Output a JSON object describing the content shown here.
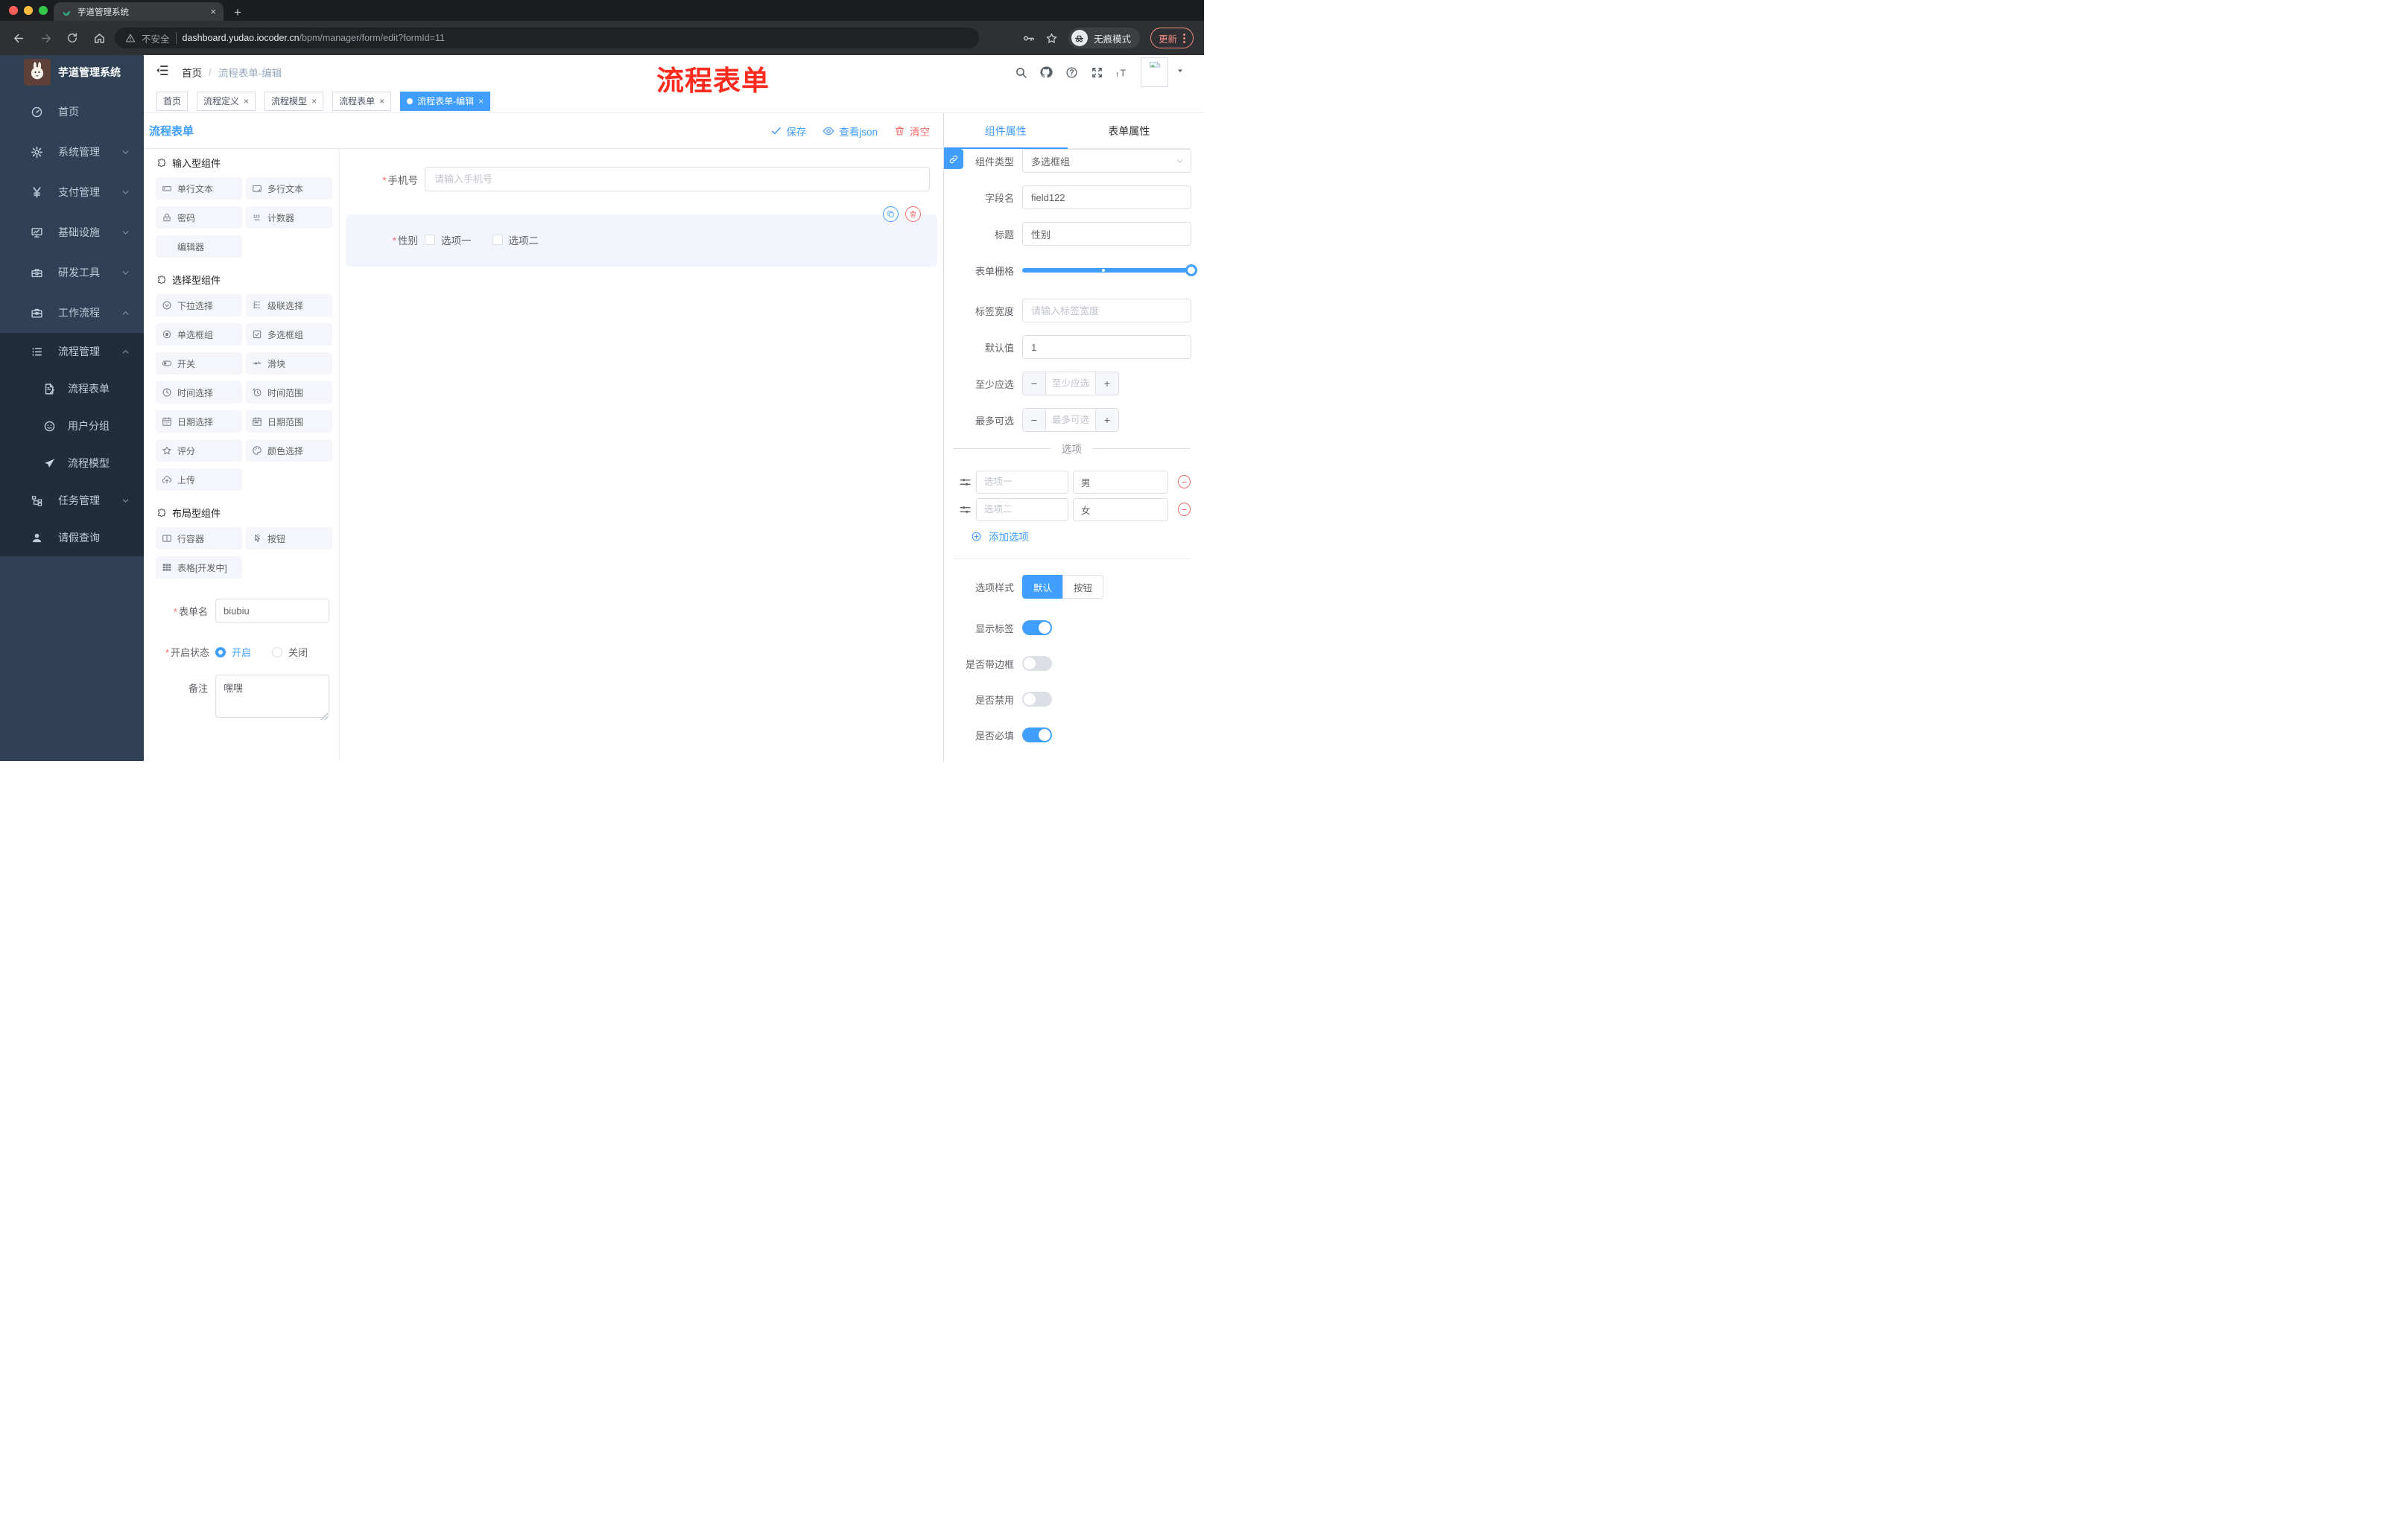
{
  "colors": {
    "accent": "#409eff",
    "danger": "#f56c6c",
    "sidebar_bg": "#304156",
    "submenu_bg": "#1f2d3d",
    "tag_active_bg": "#409eff"
  },
  "browser": {
    "tab_title": "芋道管理系统",
    "security_label": "不安全",
    "url_host": "dashboard.yudao.iocoder.cn",
    "url_path": "/bpm/manager/form/edit?formId=11",
    "incognito_label": "无痕模式",
    "update_label": "更新"
  },
  "sidebar": {
    "logo_title": "芋道管理系统",
    "top_items": [
      {
        "label": "首页",
        "icon": "ic-gauge"
      },
      {
        "label": "系统管理",
        "icon": "ic-gear",
        "classes": [
          "chev-down"
        ]
      },
      {
        "label": "支付管理",
        "icon": "ic-yen",
        "classes": [
          "chev-down"
        ]
      },
      {
        "label": "基础设施",
        "icon": "ic-monitor",
        "classes": [
          "chev-down"
        ]
      },
      {
        "label": "研发工具",
        "icon": "ic-toolbox",
        "classes": [
          "chev-down"
        ]
      },
      {
        "label": "工作流程",
        "icon": "ic-briefcase",
        "classes": [
          "chev-up"
        ]
      }
    ],
    "sub_items": [
      {
        "label": "流程管理",
        "icon": "ic-listdots",
        "classes": [
          "chev-up"
        ]
      },
      {
        "label": "流程表单",
        "icon": "ic-docedit",
        "classes": [
          "lvl2"
        ]
      },
      {
        "label": "用户分组",
        "icon": "ic-face",
        "classes": [
          "lvl2"
        ]
      },
      {
        "label": "流程模型",
        "icon": "ic-plane",
        "classes": [
          "lvl2"
        ]
      },
      {
        "label": "任务管理",
        "icon": "ic-tree",
        "classes": [
          "chev-down"
        ]
      },
      {
        "label": "请假查询",
        "icon": "ic-user"
      }
    ]
  },
  "header": {
    "breadcrumb_home": "首页",
    "breadcrumb_current": "流程表单-编辑",
    "annotation": "流程表单"
  },
  "tags": {
    "items": [
      {
        "label": "首页",
        "closable": false
      },
      {
        "label": "流程定义",
        "closable": true
      },
      {
        "label": "流程模型",
        "closable": true
      },
      {
        "label": "流程表单",
        "closable": true
      },
      {
        "label": "流程表单-编辑",
        "closable": true,
        "dot": true,
        "classes": [
          "active"
        ]
      }
    ]
  },
  "toolbar": {
    "title": "流程表单",
    "save_label": "保存",
    "view_json_label": "查看json",
    "clear_label": "清空"
  },
  "palette": {
    "section_input": {
      "title": "输入型组件",
      "items": [
        {
          "label": "单行文本",
          "icon": "ic-inputbox"
        },
        {
          "label": "多行文本",
          "icon": "ic-textarea"
        },
        {
          "label": "密码",
          "icon": "ic-lock"
        },
        {
          "label": "计数器",
          "icon": "ic-counter"
        },
        {
          "label": "编辑器",
          "icon": null
        }
      ]
    },
    "section_select": {
      "title": "选择型组件",
      "items": [
        {
          "label": "下拉选择",
          "icon": "ic-selcircle"
        },
        {
          "label": "级联选择",
          "icon": "ic-cascade"
        },
        {
          "label": "单选框组",
          "icon": "ic-radio"
        },
        {
          "label": "多选框组",
          "icon": "ic-checkbox"
        },
        {
          "label": "开关",
          "icon": "ic-switch"
        },
        {
          "label": "滑块",
          "icon": "ic-sliderline"
        },
        {
          "label": "时间选择",
          "icon": "ic-clock"
        },
        {
          "label": "时间范围",
          "icon": "ic-clockrange"
        },
        {
          "label": "日期选择",
          "icon": "ic-calendar"
        },
        {
          "label": "日期范围",
          "icon": "ic-calrange"
        },
        {
          "label": "评分",
          "icon": "ic-star"
        },
        {
          "label": "颜色选择",
          "icon": "ic-palette"
        },
        {
          "label": "上传",
          "icon": "ic-upload"
        }
      ]
    },
    "section_layout": {
      "title": "布局型组件",
      "items": [
        {
          "label": "行容器",
          "icon": "ic-columns"
        },
        {
          "label": "按钮",
          "icon": "ic-pointer"
        },
        {
          "label": "表格[开发中]",
          "icon": "ic-table"
        }
      ]
    }
  },
  "form_meta": {
    "name_label": "表单名",
    "name_value": "biubiu",
    "status_label": "开启状态",
    "status_on": "开启",
    "status_off": "关闭",
    "remark_label": "备注",
    "remark_value": "嘿嘿"
  },
  "canvas": {
    "phone": {
      "label": "手机号",
      "placeholder": "请输入手机号"
    },
    "gender": {
      "label": "性别",
      "options": [
        "选项一",
        "选项二"
      ]
    }
  },
  "props": {
    "tab_component": "组件属性",
    "tab_form": "表单属性",
    "type_label": "组件类型",
    "type_value": "多选框组",
    "field_label": "字段名",
    "field_value": "field122",
    "title_label": "标题",
    "title_value": "性别",
    "grid_label": "表单栅格",
    "width_label": "标签宽度",
    "width_placeholder": "请输入标签宽度",
    "default_label": "默认值",
    "default_value": "1",
    "min_label": "至少应选",
    "min_placeholder": "至少应选",
    "max_label": "最多可选",
    "max_placeholder": "最多可选",
    "options_divider": "选项",
    "options": [
      {
        "placeholder": "选项一",
        "value": "男"
      },
      {
        "placeholder": "选项二",
        "value": "女"
      }
    ],
    "add_option_label": "添加选项",
    "style_label": "选项样式",
    "style_options": [
      {
        "label": "默认",
        "classes": [
          "active",
          "first"
        ]
      },
      {
        "label": "按钮",
        "classes": [
          "last"
        ]
      }
    ],
    "toggles": [
      {
        "label": "显示标签",
        "classes": [
          "on"
        ]
      },
      {
        "label": "是否带边框",
        "classes": []
      },
      {
        "label": "是否禁用",
        "classes": []
      },
      {
        "label": "是否必填",
        "classes": [
          "on"
        ]
      }
    ]
  }
}
